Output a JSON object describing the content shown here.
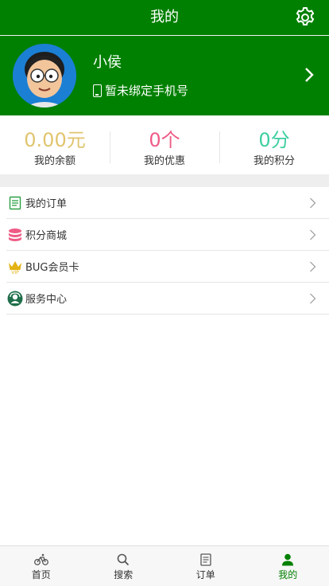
{
  "header": {
    "title": "我的"
  },
  "profile": {
    "name": "小侯",
    "phone_text": "暂未绑定手机号"
  },
  "stats": [
    {
      "value": "0.00元",
      "label": "我的余额",
      "color": "#e0c46e"
    },
    {
      "value": "0个",
      "label": "我的优惠",
      "color": "#ef5b86"
    },
    {
      "value": "0分",
      "label": "我的积分",
      "color": "#3ecfa0"
    }
  ],
  "menu": [
    {
      "label": "我的订单",
      "icon": "order-list-icon",
      "color": "#2aa043"
    },
    {
      "label": "积分商城",
      "icon": "coins-stack-icon",
      "color": "#ef5b86"
    },
    {
      "label": "BUG会员卡",
      "icon": "vip-crown-icon",
      "color": "#e3b314"
    },
    {
      "label": "服务中心",
      "icon": "service-icon",
      "color": "#1f6f4a"
    }
  ],
  "tabbar": [
    {
      "label": "首页",
      "icon": "bike-icon",
      "active": false
    },
    {
      "label": "搜索",
      "icon": "search-icon",
      "active": false
    },
    {
      "label": "订单",
      "icon": "order-icon",
      "active": false
    },
    {
      "label": "我的",
      "icon": "user-icon",
      "active": true
    }
  ],
  "colors": {
    "brand": "#008000",
    "active_tab": "#008000"
  }
}
